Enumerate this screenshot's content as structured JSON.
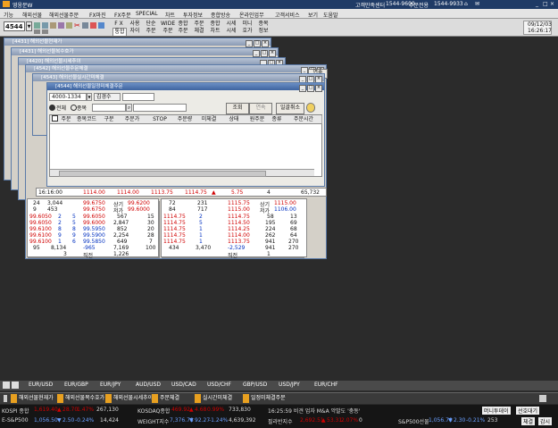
{
  "app": {
    "title": "영웅문W",
    "phone_label": "고객만족센터",
    "phone1": "1544-9600",
    "phone_label2": "주문전용",
    "phone2": "1544-9933",
    "date": "09/12/03",
    "time": "16:26:17"
  },
  "menu": [
    "기능",
    "해외선물",
    "해외선물주문",
    "FX마진",
    "FX주문",
    "SPECIAL",
    "차트",
    "투자정보",
    "종합방송",
    "온라인업무",
    "고객서비스",
    "보기",
    "도움말"
  ],
  "toolbar": {
    "screen_no": "4544",
    "buttons": [
      "F X",
      "사용",
      "단순",
      "WIDE",
      "종합",
      "주문",
      "종합",
      "시세",
      "미니",
      "종목"
    ],
    "buttons2": [
      "통합",
      "자이",
      "주문",
      "주문",
      "주문",
      "체결",
      "차트",
      "시세",
      "호가",
      "정보"
    ]
  },
  "windows": {
    "w1": "[4431] 해외선물현재가",
    "w2": "[4431] 해외선물복수호가",
    "w3": "[4420] 해외선물시세추이",
    "w4": "[4542] 해외선물주문체결",
    "w5": "[4543] 해외선물실시간미체결",
    "w6": "[4544] 해외선물일정미체결주문"
  },
  "order_window": {
    "account": "4000-1334",
    "account_name": "김경수",
    "radio_all": "전체",
    "radio_item": "종목",
    "btn_query": "조회",
    "btn_next": "연속",
    "btn_cancel_all": "일괄취소",
    "btn_link": "연속",
    "columns": [
      "주문",
      "종목코드",
      "구분",
      "주문가",
      "STOP",
      "주문량",
      "미체결",
      "상태",
      "원주문",
      "종류",
      "주문시간"
    ]
  },
  "quote_row": {
    "time": "16:16:00",
    "price1": "1114.00",
    "price2": "1114.00",
    "price3": "1113.75",
    "price4": "1114.75",
    "change": "5.75",
    "qty": "4",
    "volume": "65,732"
  },
  "orderbook_left": {
    "top": [
      [
        "24",
        "3,044",
        "99.6750",
        "상기",
        "99.6200"
      ],
      [
        "9",
        "453",
        "99.6750",
        "저가",
        "99.6000"
      ]
    ],
    "rows": [
      [
        "5",
        "99.6050",
        "567",
        "15"
      ],
      [
        "5",
        "99.6000",
        "2,847",
        "30"
      ],
      [
        "8",
        "99.5950",
        "852",
        "20"
      ],
      [
        "9",
        "99.5900",
        "2,254",
        "28"
      ],
      [
        "6",
        "99.5850",
        "649",
        "7"
      ]
    ],
    "rows_left": [
      [
        "99.6050",
        "2"
      ],
      [
        "99.6050",
        "2"
      ],
      [
        "99.6100",
        "8"
      ],
      [
        "99.6100",
        "9"
      ],
      [
        "99.6100",
        "1"
      ]
    ],
    "sum": [
      "95",
      "8,134",
      "-965",
      "7,169",
      "100"
    ],
    "bottom": [
      "3",
      "직전",
      "1,226"
    ]
  },
  "orderbook_right": {
    "top": [
      [
        "72",
        "231",
        "1115.75",
        "상기",
        "1115.00"
      ],
      [
        "84",
        "717",
        "1115.00",
        "저가",
        "1106.00"
      ]
    ],
    "rows": [
      [
        "1114.75",
        "2",
        "1114.75",
        "58",
        "13"
      ],
      [
        "1114.75",
        "5",
        "1114.50",
        "195",
        "69"
      ],
      [
        "1114.75",
        "1",
        "1114.25",
        "224",
        "68"
      ],
      [
        "1114.75",
        "1",
        "1114.00",
        "262",
        "64"
      ],
      [
        "1114.75",
        "1",
        "1113.75",
        "941",
        "270"
      ]
    ],
    "sum": [
      "434",
      "3,470",
      "-2,529",
      "941",
      "270"
    ],
    "bottom": [
      "직전",
      "1"
    ]
  },
  "bottom_tabs": [
    "EUR/USD",
    "EUR/GBP",
    "EUR/JPY",
    "AUD/USD",
    "USD/CAD",
    "USD/CHF",
    "GBP/USD",
    "USD/JPY",
    "EUR/CHF"
  ],
  "task_tabs": [
    "해외선물현재가",
    "해외선물복수호가",
    "해외선물시세추이",
    "주문체결",
    "실시간미체결",
    "일정미체결주문"
  ],
  "ticker": {
    "kospi_label": "KOSPI 종합",
    "kospi": "1,619.40",
    "kospi_chg": "28.70",
    "kospi_pct": "1.47%",
    "kospi_vol": "267,130",
    "kosdaq_label": "KOSDAQ종합",
    "kosdaq": "469.92",
    "kosdaq_chg": "4.68",
    "kosdaq_pct": "0.99%",
    "kosdaq_vol": "733,830",
    "news": "16:25:59 비견 업자 M&A 악발도 '충동'",
    "mini": "머니투데이",
    "sp_label": "E-S&P500",
    "sp": "1,056.50",
    "sp_chg": "2.50",
    "sp_pct": "-0.24%",
    "sp_vol": "14,424",
    "weight_label": "WEIGHT지수",
    "weight": "7,376.78",
    "weight_chg": "92.27",
    "weight_pct": "-1.24%",
    "weight_vol": "4,639,392",
    "phil_label": "필라반지수",
    "phil": "2,692.51",
    "phil_chg": "53.31",
    "phil_pct": "2.07%",
    "phil_vol": "0",
    "sp500_label": "S&P500선물",
    "sp500": "1,056.70",
    "sp500_chg": "2.30",
    "sp500_pct": "-0.21%",
    "sp500_vol": "253",
    "btn_favorite": "선호대기",
    "btn_settle": "체결",
    "btn_monitor": "감시"
  },
  "colors": {
    "desktop": "#2b2b2b",
    "title_active": "#3e64a0",
    "up": "#d00000",
    "down": "#0030c0"
  }
}
